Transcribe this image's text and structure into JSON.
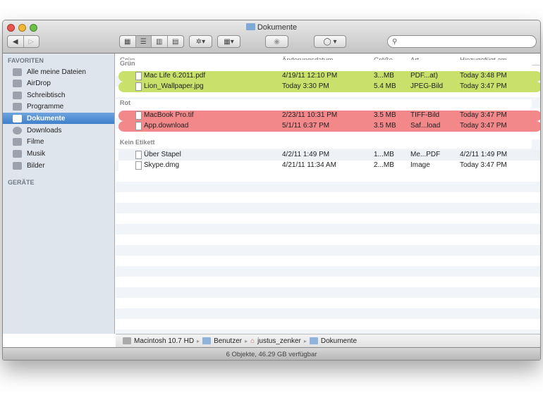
{
  "window": {
    "title": "Dokumente"
  },
  "toolbar": {
    "back": "◀",
    "forward": "▷",
    "views": [
      "▦",
      "☰",
      "▥",
      "▤"
    ],
    "action": "✲▾",
    "arrange": "▦▾",
    "quicklook": "◉",
    "share": "◯ ▾",
    "search_placeholder": "",
    "search_icon": "⚲"
  },
  "sidebar": {
    "favorites_title": "FAVORITEN",
    "devices_title": "GERÄTE",
    "items": [
      {
        "label": "Alle meine Dateien",
        "icon": "all-files-icon"
      },
      {
        "label": "AirDrop",
        "icon": "airdrop-icon"
      },
      {
        "label": "Schreibtisch",
        "icon": "desktop-icon"
      },
      {
        "label": "Programme",
        "icon": "applications-icon"
      },
      {
        "label": "Dokumente",
        "icon": "documents-icon",
        "selected": true
      },
      {
        "label": "Downloads",
        "icon": "downloads-icon"
      },
      {
        "label": "Filme",
        "icon": "movies-icon"
      },
      {
        "label": "Musik",
        "icon": "music-icon"
      },
      {
        "label": "Bilder",
        "icon": "pictures-icon"
      }
    ]
  },
  "columns": {
    "name": "Grün",
    "date": "Änderungsdatum",
    "size": "Größe",
    "kind": "Art",
    "added": "Hinzugefügt am"
  },
  "groups": [
    {
      "label": "Grün",
      "color": "#c9e06a",
      "files": [
        {
          "name": "Mac Life 6.2011.pdf",
          "date": "4/19/11 12:10 PM",
          "size": "3...MB",
          "kind": "PDF...at)",
          "added": "Today 3:48 PM"
        },
        {
          "name": "Lion_Wallpaper.jpg",
          "date": "Today 3:30 PM",
          "size": "5.4 MB",
          "kind": "JPEG-Bild",
          "added": "Today 3:47 PM"
        }
      ]
    },
    {
      "label": "Rot",
      "color": "#f2888a",
      "files": [
        {
          "name": "MacBook Pro.tif",
          "date": "2/23/11 10:31 PM",
          "size": "3.5 MB",
          "kind": "TIFF-Bild",
          "added": "Today 3:47 PM"
        },
        {
          "name": "App.download",
          "date": "5/1/11 6:37 PM",
          "size": "3.5 MB",
          "kind": "Saf...load",
          "added": "Today 3:47 PM"
        }
      ]
    },
    {
      "label": "Kein Etikett",
      "files": [
        {
          "name": "Über Stapel",
          "date": "4/2/11 1:49 PM",
          "size": "1...MB",
          "kind": "Me...PDF",
          "added": "4/2/11 1:49 PM"
        },
        {
          "name": "Skype.dmg",
          "date": "4/21/11 11:34 AM",
          "size": "2...MB",
          "kind": "Image",
          "added": "Today 3:47 PM"
        }
      ]
    }
  ],
  "pathbar": [
    "Macintosh 10.7 HD",
    "Benutzer",
    "justus_zenker",
    "Dokumente"
  ],
  "status": "6 Objekte, 46.29 GB verfügbar"
}
